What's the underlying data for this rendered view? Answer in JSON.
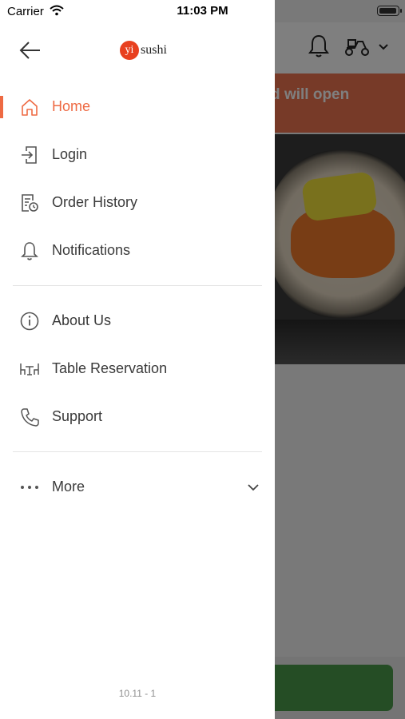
{
  "status_bar": {
    "carrier": "Carrier",
    "time": "11:03 PM"
  },
  "logo": {
    "badge": "yi",
    "word": "sushi"
  },
  "menu": {
    "primary": [
      {
        "label": "Home",
        "icon": "home-icon",
        "active": true
      },
      {
        "label": "Login",
        "icon": "login-icon"
      },
      {
        "label": "Order History",
        "icon": "order-history-icon"
      },
      {
        "label": "Notifications",
        "icon": "bell-icon"
      }
    ],
    "secondary": [
      {
        "label": "About Us",
        "icon": "info-icon"
      },
      {
        "label": "Table Reservation",
        "icon": "table-icon"
      },
      {
        "label": "Support",
        "icon": "phone-icon"
      }
    ],
    "more": {
      "label": "More",
      "icon": "more-dots-icon"
    }
  },
  "version": "10.11 - 1",
  "background": {
    "banner_text": "d and will open"
  },
  "colors": {
    "accent": "#ee6a43",
    "banner": "#ee7450",
    "text": "#3a3a3a"
  }
}
